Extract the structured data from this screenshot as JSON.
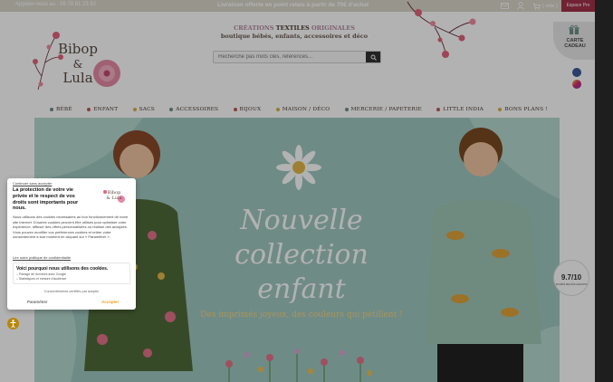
{
  "topbar": {
    "phone_label": "Appeler-nous au : 09 78 81 23 92",
    "delivery_label": "Livraison offerte en point relais à partir de 70€ d'achat",
    "cart_label": "( vide )",
    "pro_label": "Espace Pro"
  },
  "header": {
    "logo_text": [
      "Bibop",
      "&",
      "Lula"
    ],
    "tagline_part1": "CRÉATIONS",
    "tagline_part2": "TEXTILES",
    "tagline_part3": "ORIGINALES",
    "tagline_sub": "boutique bébés, enfants, accessoires et déco",
    "search_placeholder": "Recherche pas mots clés, références...",
    "gift_label": [
      "CARTE",
      "CADEAU"
    ]
  },
  "nav": {
    "items": [
      {
        "label": "BÉBÉ",
        "color": "#6e8f87"
      },
      {
        "label": "ENFANT",
        "color": "#c25a5a"
      },
      {
        "label": "SACS",
        "color": "#d4b04a"
      },
      {
        "label": "ACCESSOIRES",
        "color": "#6e8f87"
      },
      {
        "label": "BIJOUX",
        "color": "#c25a5a"
      },
      {
        "label": "MAISON / DÉCO",
        "color": "#d4b04a"
      },
      {
        "label": "MERCERIE / PAPETERIE",
        "color": "#6e8f87"
      },
      {
        "label": "LITTLE INDIA",
        "color": "#c25a5a"
      },
      {
        "label": "BONS PLANS !",
        "color": "#d4b04a"
      }
    ]
  },
  "hero": {
    "title_line1": "Nouvelle collection",
    "title_line2": "enfant",
    "subtitle": "Des imprimés joyeux, des couleurs qui pétillent !"
  },
  "badge": {
    "score": "9.7/10",
    "label": "SOCIÉTÉ DES AVIS GARANTIS"
  },
  "cookie": {
    "skip": "Continuer sans accepter",
    "heading": "La protection de votre vie privée et le respect de vos droits sont importants pour nous.",
    "logo_text": [
      "Bibop",
      "& Lula"
    ],
    "body": "Nous utilisons des cookies nécessaires au bon fonctionnement de notre site internet. D'autres cookies peuvent être utilisés pour optimiser votre expérience, diffuser des offres personnalisées ou réaliser des analyses. Vous pouvez modifier vos préférences cookies et retirer votre consentement à tout moment en cliquant sur « Paramétrer ».",
    "policy_link": "Lire notre politique de confidentialité",
    "why_title": "Voici pourquoi nous utilisons des cookies.",
    "why_line1": "– Partage de données avec Google",
    "why_line2": "– Statistiques et mesure d'audience",
    "certified": "Consentements certifiés par  axeptio",
    "param_label": "Paramétrer",
    "accept_label": "Accepter"
  }
}
